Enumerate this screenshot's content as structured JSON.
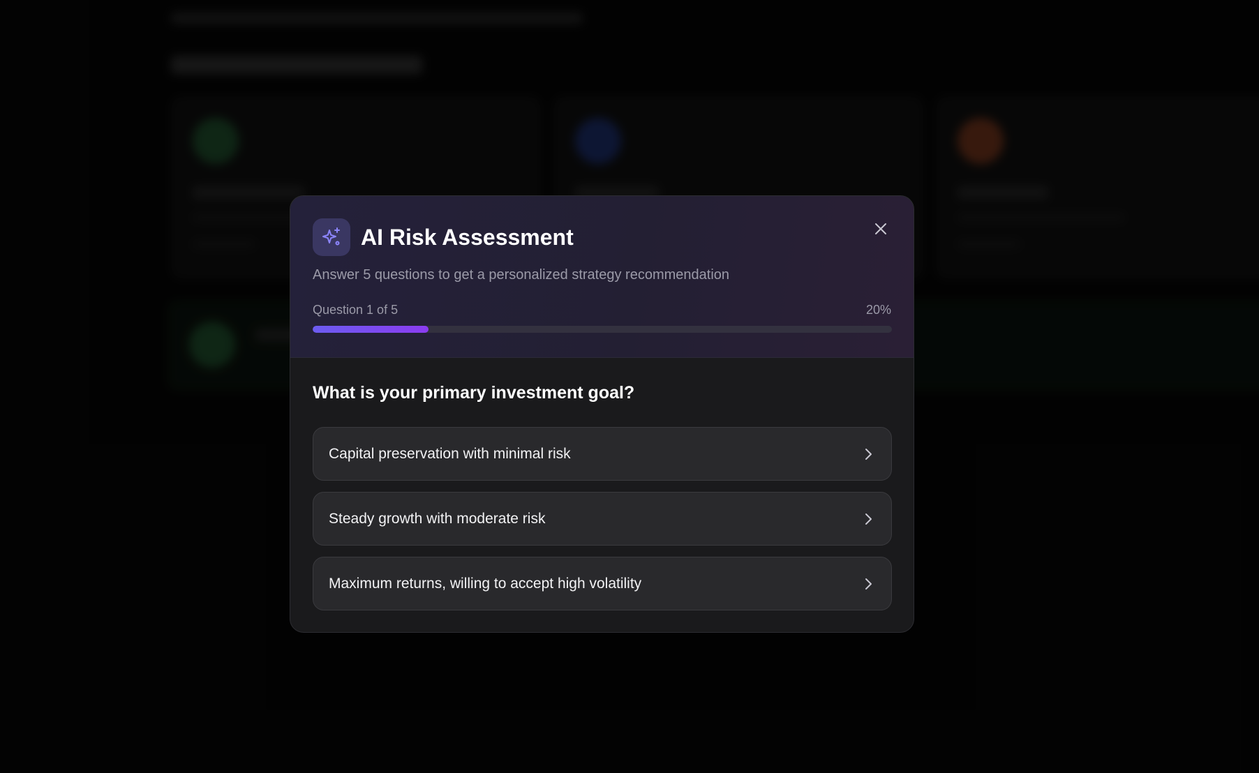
{
  "modal": {
    "title": "AI Risk Assessment",
    "subtitle": "Answer 5 questions to get a personalized strategy recommendation",
    "icon": "sparkles-icon",
    "close_icon": "close-icon",
    "progress": {
      "label": "Question 1 of 5",
      "percent_label": "20%",
      "fraction": 0.2
    },
    "question": "What is your primary investment goal?",
    "options": [
      {
        "label": "Capital preservation with minimal risk",
        "icon": "chevron-right-icon"
      },
      {
        "label": "Steady growth with moderate risk",
        "icon": "chevron-right-icon"
      },
      {
        "label": "Maximum returns, willing to accept high volatility",
        "icon": "chevron-right-icon"
      }
    ]
  },
  "colors": {
    "accent": "#6c5cf0",
    "accent_end": "#8b3cf0",
    "icon_tint": "#8d86ff",
    "background_card_green": "#2f7a44",
    "background_card_blue": "#2a47a8",
    "background_card_orange": "#b5522a"
  }
}
